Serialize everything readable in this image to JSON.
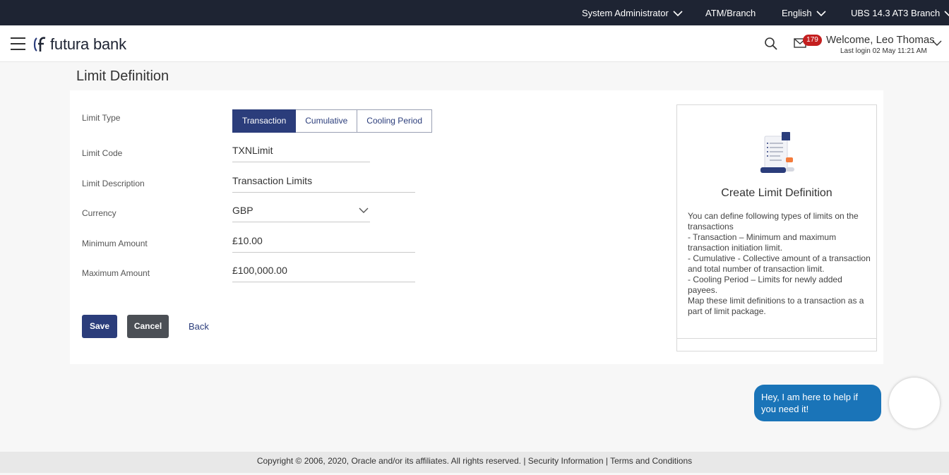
{
  "topbar": {
    "role": "System Administrator",
    "location": "ATM/Branch",
    "language": "English",
    "branch": "UBS 14.3 AT3 Branch"
  },
  "header": {
    "brand": "futura bank",
    "notification_count": "179",
    "welcome": "Welcome, Leo Thomas",
    "last_login": "Last login 02 May 11:21 AM"
  },
  "page": {
    "title": "Limit Definition"
  },
  "form": {
    "limit_type_label": "Limit Type",
    "limit_types": [
      "Transaction",
      "Cumulative",
      "Cooling Period"
    ],
    "selected_limit_type": "Transaction",
    "limit_code_label": "Limit Code",
    "limit_code_value": "TXNLimit",
    "limit_description_label": "Limit Description",
    "limit_description_value": "Transaction Limits",
    "currency_label": "Currency",
    "currency_value": "GBP",
    "minimum_amount_label": "Minimum Amount",
    "minimum_amount_value": "£10.00",
    "maximum_amount_label": "Maximum Amount",
    "maximum_amount_value": "£100,000.00",
    "save_label": "Save",
    "cancel_label": "Cancel",
    "back_label": "Back"
  },
  "help": {
    "title": "Create Limit Definition",
    "lines": [
      "You can define following types of limits on the transactions",
      "- Transaction – Minimum and maximum transaction initiation limit.",
      "- Cumulative - Collective amount of a transaction and total number of transaction limit.",
      "- Cooling Period – Limits for newly added payees.",
      "Map these limit definitions to a transaction as a part of limit package."
    ]
  },
  "chat": {
    "message": "Hey, I am here to help if you need it!"
  },
  "footer": {
    "copyright": "Copyright © 2006, 2020, Oracle and/or its affiliates. All rights reserved.",
    "security": "Security Information",
    "terms": "Terms and Conditions"
  },
  "colors": {
    "topbar_bg": "#1e2433",
    "primary": "#2b3d7b",
    "badge": "#c41f1f",
    "chat": "#1a74b8"
  },
  "icons": [
    "menu-icon",
    "futura-logo-icon",
    "search-icon",
    "mail-icon",
    "chevron-down-icon",
    "limit-illustration-icon"
  ]
}
